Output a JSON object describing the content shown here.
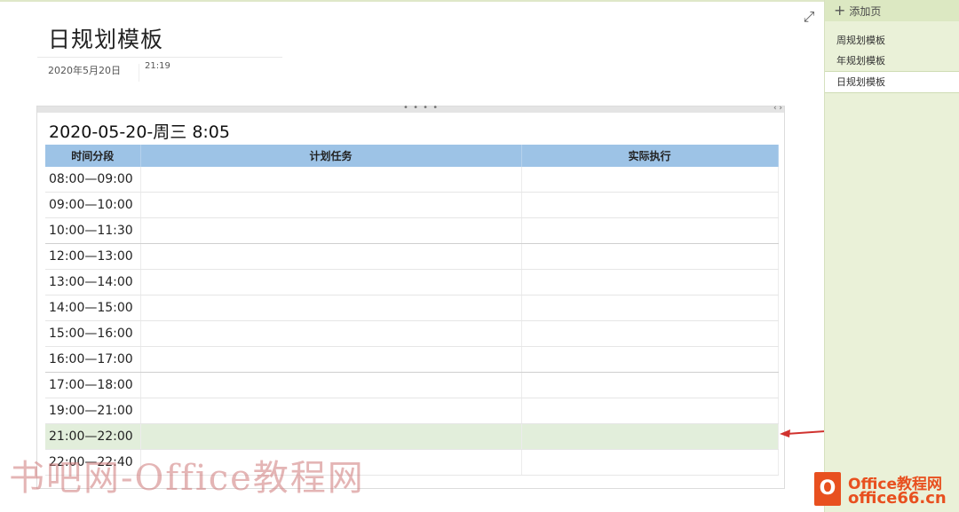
{
  "page": {
    "title": "日规划模板",
    "date": "2020年5月20日",
    "time": "21:19"
  },
  "toolbar": {
    "expand_icon": "expand-icon",
    "container_handle_icon": "drag-handle-icon",
    "container_resize_icon": "resize-arrows-icon"
  },
  "note": {
    "heading": "2020-05-20-周三 8:05",
    "table": {
      "headers": [
        "时间分段",
        "计划任务",
        "实际执行"
      ],
      "rows": [
        {
          "time": "08:00—09:00",
          "plan": "",
          "actual": ""
        },
        {
          "time": "09:00—10:00",
          "plan": "",
          "actual": ""
        },
        {
          "time": "10:00—11:30",
          "plan": "",
          "actual": ""
        },
        {
          "time": "12:00—13:00",
          "plan": "",
          "actual": ""
        },
        {
          "time": "13:00—14:00",
          "plan": "",
          "actual": ""
        },
        {
          "time": "14:00—15:00",
          "plan": "",
          "actual": ""
        },
        {
          "time": "15:00—16:00",
          "plan": "",
          "actual": ""
        },
        {
          "time": "16:00—17:00",
          "plan": "",
          "actual": ""
        },
        {
          "time": "17:00—18:00",
          "plan": "",
          "actual": ""
        },
        {
          "time": "19:00—21:00",
          "plan": "",
          "actual": ""
        },
        {
          "time": "21:00—22:00",
          "plan": "",
          "actual": "",
          "highlighted": true
        },
        {
          "time": "22:00—22:40",
          "plan": "",
          "actual": ""
        }
      ],
      "header_color": "#9dc3e6",
      "highlight_color": "#e2eedb"
    }
  },
  "sidebar": {
    "add_page_label": "添加页",
    "add_page_icon": "plus-icon",
    "pages": [
      {
        "label": "周规划模板",
        "active": false
      },
      {
        "label": "年规划模板",
        "active": false
      },
      {
        "label": "日规划模板",
        "active": true
      }
    ],
    "background_color": "#eaf1d8"
  },
  "overlay": {
    "watermark": "书吧网-Office教程网",
    "logo_line1": "Office教程网",
    "logo_line2": "office66.cn",
    "annotation_arrow_color": "#d0322e"
  }
}
